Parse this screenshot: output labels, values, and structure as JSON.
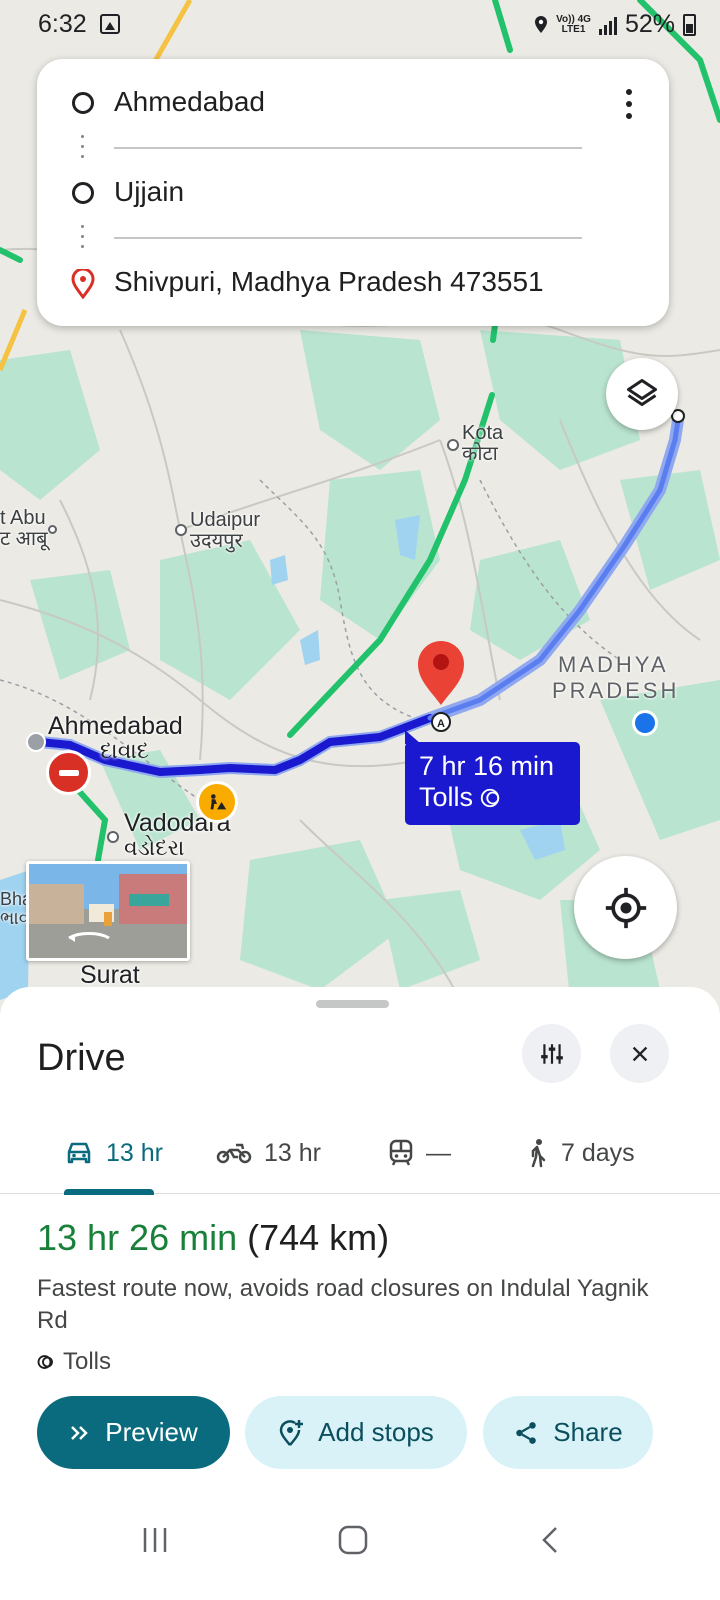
{
  "status_bar": {
    "time": "6:32",
    "network_top": "Vo)) 4G",
    "network_bottom": "LTE1",
    "battery": "52%"
  },
  "directions": {
    "origin": "Ahmedabad",
    "waypoint": "Ujjain",
    "destination": "Shivpuri, Madhya Pradesh 473551"
  },
  "map": {
    "labels": {
      "kota": "Kota",
      "kota_hi": "कोटा",
      "udaipur": "Udaipur",
      "udaipur_hi": "उदयपुर",
      "mt_abu": "t Abu",
      "mt_abu_hi": "ट आबू",
      "ahmedabad": "Ahmedabad",
      "ahmedabad_gu": "દાવાદ",
      "vadodara": "Vadodara",
      "vadodara_gu": "વડોદરા",
      "surat": "Surat",
      "bhav": "Bha",
      "bhav2": "ભાવ",
      "madhya": "MADHYA",
      "pradesh": "PRADESH"
    },
    "route_bubble": {
      "duration": "7 hr 16 min",
      "tolls": "Tolls"
    },
    "colors": {
      "route": "#1a19cf",
      "traffic": "#22c16b",
      "water": "#9fd3f0",
      "forest": "#b9e4cf"
    }
  },
  "sheet": {
    "title": "Drive",
    "tabs": [
      {
        "icon": "car-icon",
        "label": "13 hr"
      },
      {
        "icon": "motorcycle-icon",
        "label": "13 hr"
      },
      {
        "icon": "transit-icon",
        "label": "—"
      },
      {
        "icon": "walk-icon",
        "label": "7 days"
      }
    ],
    "duration": "13 hr 26 min",
    "distance": "(744 km)",
    "description": "Fastest route now, avoids road closures on Indulal Yagnik Rd",
    "tolls": "Tolls",
    "buttons": {
      "preview": "Preview",
      "add_stops": "Add stops",
      "share": "Share"
    },
    "accent": "#0b6b7e"
  }
}
